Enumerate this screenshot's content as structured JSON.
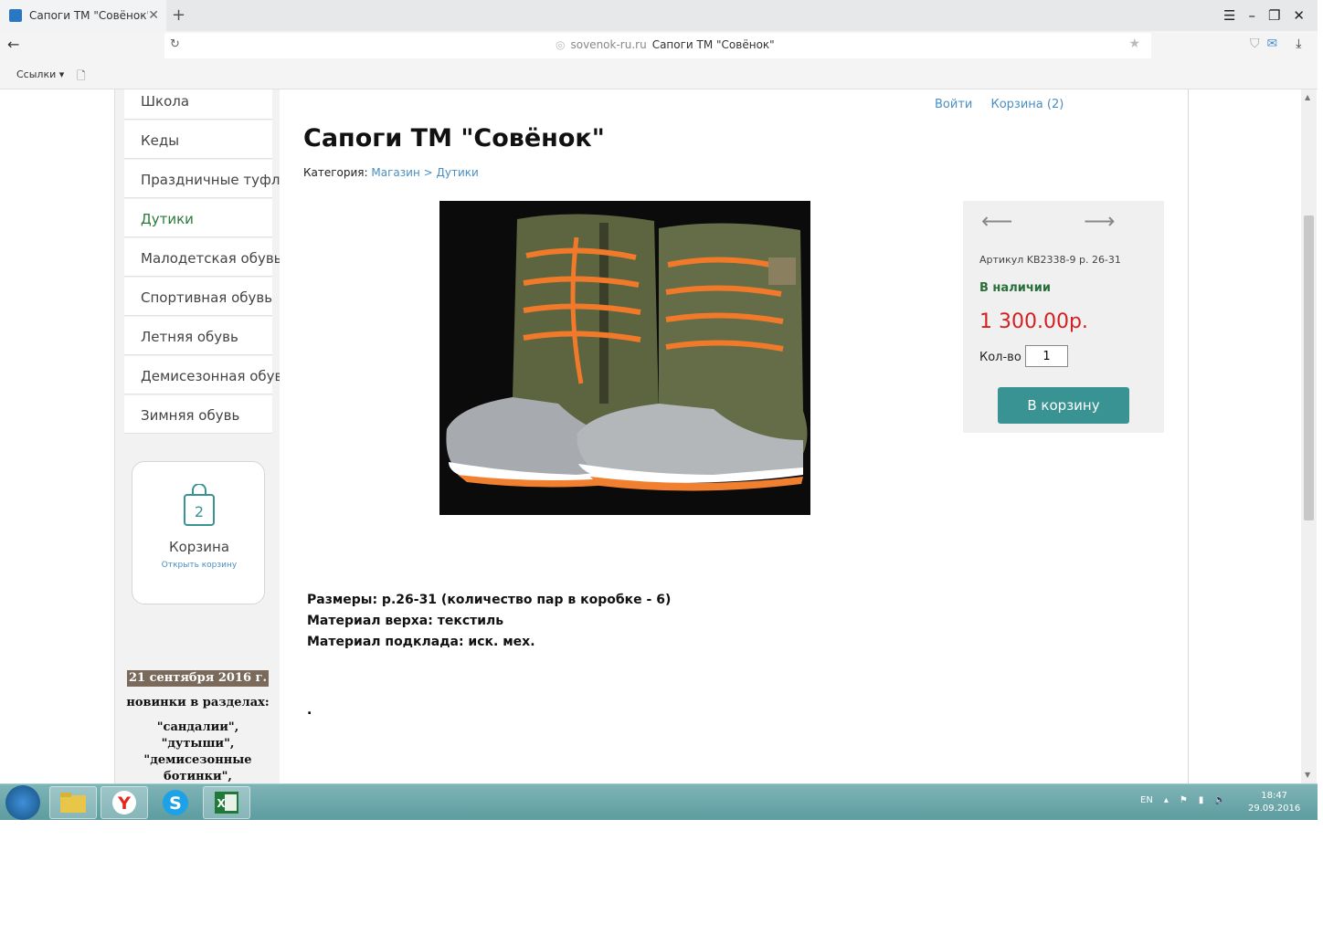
{
  "browser": {
    "tab_title": "Сапоги ТМ \"Совёнок\"",
    "url_domain": "sovenok-ru.ru",
    "url_title": "Сапоги ТМ \"Совёнок\"",
    "bookmarks_label": "Ссылки ▾"
  },
  "sidebar": {
    "menu": [
      {
        "label": "Школа"
      },
      {
        "label": "Кеды"
      },
      {
        "label": "Праздничные туфли"
      },
      {
        "label": "Дутики"
      },
      {
        "label": "Малодетская обувь"
      },
      {
        "label": "Спортивная обувь"
      },
      {
        "label": "Летняя обувь"
      },
      {
        "label": "Демисезонная обувь"
      },
      {
        "label": "Зимняя обувь"
      }
    ],
    "cart": {
      "count": "2",
      "title": "Корзина",
      "open_link": "Открыть корзину"
    },
    "news": {
      "date": "21 сентября 2016 г.",
      "subtitle": "новинки в разделах:",
      "text": "\"сандалии\", \"дутыши\", \"демисезонные ботинки\", \"праздничные туфли\","
    }
  },
  "header": {
    "login": "Войти",
    "cart_link": "Корзина (2)"
  },
  "product": {
    "title": "Сапоги ТМ \"Совёнок\"",
    "category_label": "Категория:",
    "category_path": "Магазин > Дутики",
    "sku": "Артикул KB2338-9 р. 26-31",
    "availability": "В наличии",
    "price": "1 300.00р.",
    "qty_label": "Кол-во",
    "qty_value": "1",
    "add_to_cart": "В корзину",
    "description": [
      "Размеры: р.26-31 (количество пар в коробке - 6)",
      "Материал верха: текстиль",
      "Материал подклада: иск. мех."
    ],
    "trailing_dot": "."
  },
  "taskbar": {
    "lang": "EN",
    "time": "18:47",
    "date": "29.09.2016"
  },
  "colors": {
    "accent": "#3a9393",
    "price": "#d42020",
    "link": "#4a8fc2",
    "in_stock": "#2a6e3a",
    "taskbar": "#6aa8ab"
  }
}
